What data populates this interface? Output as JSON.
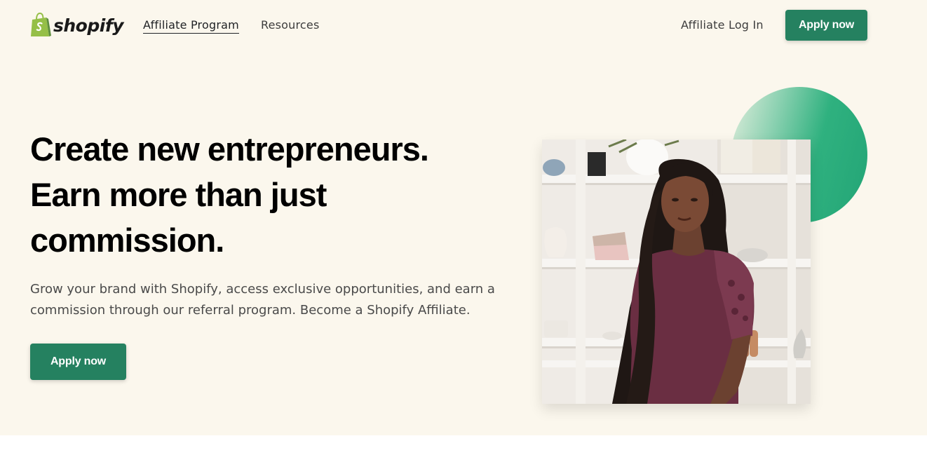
{
  "header": {
    "logo_text": "shopify",
    "nav": [
      {
        "label": "Affiliate Program"
      },
      {
        "label": "Resources"
      }
    ],
    "login_label": "Affiliate Log In",
    "apply_label": "Apply now"
  },
  "hero": {
    "headline_lines": [
      "Create new entrepreneurs.",
      "Earn more than just",
      "commission."
    ],
    "subtext": "Grow your brand with Shopify, access exclusive opportunities, and earn a commission through our referral program. Become a Shopify Affiliate.",
    "cta_label": "Apply now"
  },
  "colors": {
    "hero_bg": "#fbf7ed",
    "brand_green": "#258160",
    "logo_green": "#95bf47"
  },
  "icons": {
    "logo": "shopify-bag-icon"
  }
}
